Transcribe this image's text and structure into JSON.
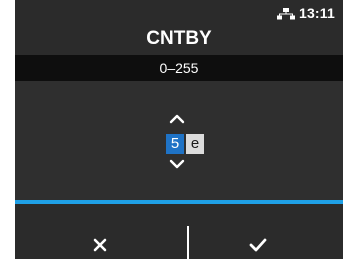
{
  "status_bar": {
    "network_icon": "network-icon",
    "time": "13:11"
  },
  "header": {
    "title": "CNTBY"
  },
  "range": {
    "text": "0–255"
  },
  "editor": {
    "up_icon": "chevron-up-icon",
    "down_icon": "chevron-down-icon",
    "digits": [
      {
        "value": "5",
        "selected": true
      },
      {
        "value": "e",
        "selected": false
      }
    ]
  },
  "footer": {
    "cancel_icon": "close-icon",
    "ok_icon": "checkmark-icon"
  },
  "colors": {
    "background": "#2b2b2b",
    "range_bar": "#0e0e0e",
    "selected_digit": "#1f73c6",
    "accent_line": "#1fa0e6"
  }
}
